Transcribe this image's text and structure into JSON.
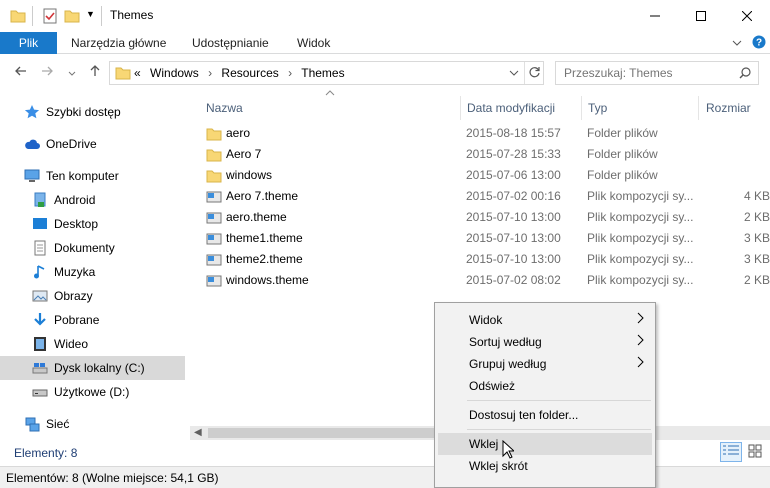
{
  "window": {
    "title": "Themes"
  },
  "ribbon": {
    "tabs": [
      "Plik",
      "Narzędzia główne",
      "Udostępnianie",
      "Widok"
    ]
  },
  "address": {
    "prefix": "«",
    "crumbs": [
      "Windows",
      "Resources",
      "Themes"
    ],
    "search_placeholder": "Przeszukaj: Themes"
  },
  "nav": {
    "quick": "Szybki dostęp",
    "onedrive": "OneDrive",
    "computer": "Ten komputer",
    "items": [
      "Android",
      "Desktop",
      "Dokumenty",
      "Muzyka",
      "Obrazy",
      "Pobrane",
      "Wideo",
      "Dysk lokalny (C:)",
      "Użytkowe (D:)"
    ],
    "network": "Sieć"
  },
  "columns": {
    "name": "Nazwa",
    "date": "Data modyfikacji",
    "type": "Typ",
    "size": "Rozmiar"
  },
  "files": [
    {
      "name": "aero",
      "date": "2015-08-18 15:57",
      "type": "Folder plików",
      "size": "",
      "kind": "folder"
    },
    {
      "name": "Aero 7",
      "date": "2015-07-28 15:33",
      "type": "Folder plików",
      "size": "",
      "kind": "folder"
    },
    {
      "name": "windows",
      "date": "2015-07-06 13:00",
      "type": "Folder plików",
      "size": "",
      "kind": "folder"
    },
    {
      "name": "Aero 7.theme",
      "date": "2015-07-02 00:16",
      "type": "Plik kompozycji sy...",
      "size": "4 KB",
      "kind": "theme"
    },
    {
      "name": "aero.theme",
      "date": "2015-07-10 13:00",
      "type": "Plik kompozycji sy...",
      "size": "2 KB",
      "kind": "theme"
    },
    {
      "name": "theme1.theme",
      "date": "2015-07-10 13:00",
      "type": "Plik kompozycji sy...",
      "size": "3 KB",
      "kind": "theme"
    },
    {
      "name": "theme2.theme",
      "date": "2015-07-10 13:00",
      "type": "Plik kompozycji sy...",
      "size": "3 KB",
      "kind": "theme"
    },
    {
      "name": "windows.theme",
      "date": "2015-07-02 08:02",
      "type": "Plik kompozycji sy...",
      "size": "2 KB",
      "kind": "theme"
    }
  ],
  "element_count": "Elementy: 8",
  "status": "Elementów: 8 (Wolne miejsce: 54,1 GB)",
  "context_menu": {
    "view": "Widok",
    "sort": "Sortuj według",
    "group": "Grupuj według",
    "refresh": "Odśwież",
    "customize": "Dostosuj ten folder...",
    "paste": "Wklej",
    "paste_shortcut": "Wklej skrót"
  },
  "colors": {
    "accent": "#1979ca",
    "folder": "#f8d775",
    "selected": "#cce8ff"
  }
}
